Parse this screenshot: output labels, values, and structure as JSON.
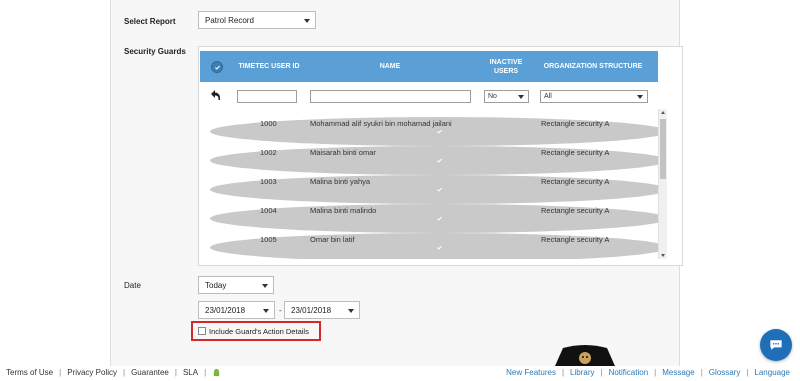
{
  "form": {
    "select_report_label": "Select Report",
    "select_report_value": "Patrol Record",
    "security_guards_label": "Security Guards",
    "date_label": "Date",
    "date_range_value": "Today",
    "date_from": "23/01/2018",
    "date_separator": "-",
    "date_to": "23/01/2018",
    "include_actions_label": "Include Guard's Action Details"
  },
  "table": {
    "headers": {
      "user_id": "TIMETEC USER ID",
      "name": "NAME",
      "inactive": "INACTIVE USERS",
      "org": "ORGANIZATION STRUCTURE"
    },
    "filters": {
      "inactive_value": "No",
      "org_value": "All"
    },
    "rows": [
      {
        "id": "1000",
        "name": "Mohammad alif syukri bin mohamad jailani",
        "org": "Rectangle security A"
      },
      {
        "id": "1002",
        "name": "Maisarah binti omar",
        "org": "Rectangle security A"
      },
      {
        "id": "1003",
        "name": "Malina binti yahya",
        "org": "Rectangle security A"
      },
      {
        "id": "1004",
        "name": "Malina binti malindo",
        "org": "Rectangle security A"
      },
      {
        "id": "1005",
        "name": "Omar bin latif",
        "org": "Rectangle security A"
      }
    ]
  },
  "footer": {
    "left": [
      "Terms of Use",
      "Privacy Policy",
      "Guarantee",
      "SLA"
    ],
    "separator": "|",
    "right": [
      "New Features",
      "Library",
      "Notification",
      "Message",
      "Glossary",
      "Language"
    ]
  },
  "colors": {
    "header_blue": "#5aa0d6",
    "highlight_red": "#d22a2a",
    "link_blue": "#2a7ab8",
    "chat_blue": "#1f6fb8"
  },
  "icons": {
    "undo": "undo-icon",
    "check": "check-icon",
    "android": "android-icon",
    "chat": "chat-bubble-icon"
  }
}
